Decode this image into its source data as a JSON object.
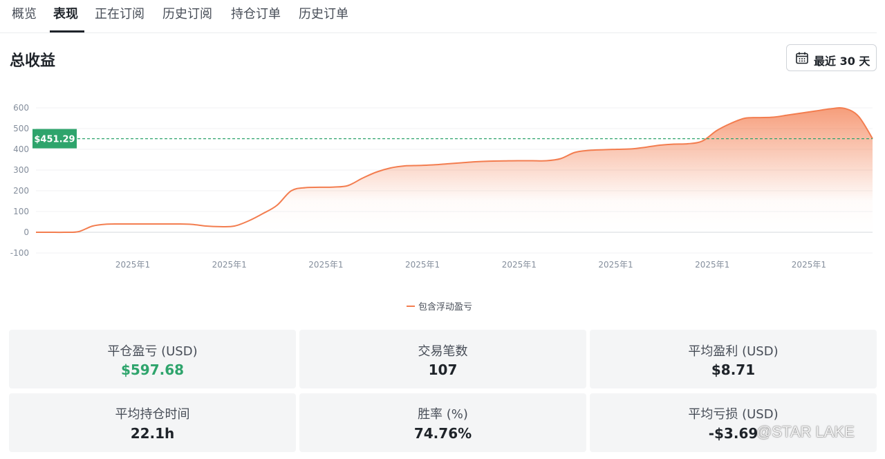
{
  "tabs": [
    {
      "label": "概览",
      "active": false
    },
    {
      "label": "表现",
      "active": true
    },
    {
      "label": "正在订阅",
      "active": false
    },
    {
      "label": "历史订阅",
      "active": false
    },
    {
      "label": "持仓订单",
      "active": false
    },
    {
      "label": "历史订单",
      "active": false
    }
  ],
  "section_title": "总收益",
  "period_button": {
    "label": "最近 30 天",
    "icon": "calendar-icon"
  },
  "chart_data": {
    "type": "area",
    "y_ticks": [
      "600",
      "500",
      "400",
      "300",
      "200",
      "100",
      "0",
      "-100"
    ],
    "ylim": [
      -100,
      600
    ],
    "x_tick_labels": [
      "2025年1",
      "2025年1",
      "2025年1",
      "2025年1",
      "2025年1",
      "2025年1",
      "2025年1",
      "2025年1"
    ],
    "series": [
      {
        "name": "包含浮动盈亏",
        "color": "#f37d4f",
        "values": [
          0,
          0,
          0,
          3,
          30,
          39,
          40,
          40,
          40,
          40,
          40,
          38,
          30,
          27,
          30,
          55,
          90,
          130,
          200,
          215,
          217,
          218,
          225,
          260,
          290,
          310,
          320,
          322,
          325,
          330,
          335,
          340,
          343,
          344,
          345,
          345,
          345,
          355,
          385,
          395,
          398,
          400,
          402,
          410,
          420,
          425,
          427,
          440,
          490,
          525,
          550,
          553,
          555,
          565,
          575,
          585,
          595,
          597.68,
          560,
          451.29
        ]
      }
    ],
    "reference_line": {
      "value": 451.29,
      "label": "$451.29",
      "color": "#2ea46c"
    }
  },
  "stats": [
    {
      "label": "平仓盈亏 (USD)",
      "value": "$597.68",
      "highlight": "green"
    },
    {
      "label": "交易笔数",
      "value": "107"
    },
    {
      "label": "平均盈利 (USD)",
      "value": "$8.71"
    },
    {
      "label": "平均持仓时间",
      "value": "22.1h"
    },
    {
      "label": "胜率 (%)",
      "value": "74.76%"
    },
    {
      "label": "平均亏损 (USD)",
      "value": "-$3.69"
    }
  ],
  "watermark": "@STAR LAKE",
  "colors": {
    "accent": "#f37d4f",
    "positive": "#2ea46c",
    "text": "#1e2329",
    "card_bg": "#f4f5f6"
  }
}
